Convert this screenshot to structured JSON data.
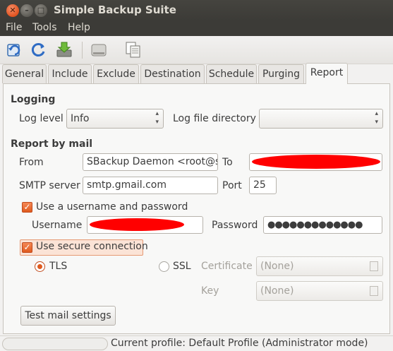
{
  "window": {
    "title": "Simple Backup Suite",
    "close_glyph": "✕",
    "min_glyph": "–",
    "max_glyph": "□"
  },
  "menu": {
    "file": "File",
    "tools": "Tools",
    "help": "Help"
  },
  "toolbar": {
    "icons": [
      "open-config-icon",
      "refresh-icon",
      "save-icon",
      "backup-now-icon",
      "restore-icon"
    ]
  },
  "tabs": [
    "General",
    "Include",
    "Exclude",
    "Destination",
    "Schedule",
    "Purging",
    "Report"
  ],
  "active_tab": "Report",
  "report": {
    "logging_header": "Logging",
    "log_level_label": "Log level",
    "log_level_value": "Info",
    "log_dir_label": "Log file directory",
    "log_dir_value": "",
    "mail_header": "Report by mail",
    "from_label": "From",
    "from_value": "SBackup Daemon <root@sk",
    "to_label": "To",
    "to_value": "",
    "smtp_label": "SMTP server",
    "smtp_value": "smtp.gmail.com",
    "port_label": "Port",
    "port_value": "25",
    "use_auth_label": "Use a username and password",
    "use_auth_checked": true,
    "username_label": "Username",
    "username_value": "",
    "password_label": "Password",
    "password_value": "●●●●●●●●●●●●●",
    "secure_label": "Use secure connection",
    "secure_checked": true,
    "tls_label": "TLS",
    "ssl_label": "SSL",
    "selected_protocol": "TLS",
    "certificate_label": "Certificate",
    "certificate_value": "(None)",
    "key_label": "Key",
    "key_value": "(None)",
    "test_button": "Test mail settings",
    "check_glyph": "✓",
    "combo_arrow": "▴▾"
  },
  "status": {
    "text": "Current profile: Default Profile  (Administrator mode)"
  },
  "colors": {
    "accent": "#df5a1e",
    "redaction": "#ff0000",
    "titlebar": "#3c3b37"
  }
}
